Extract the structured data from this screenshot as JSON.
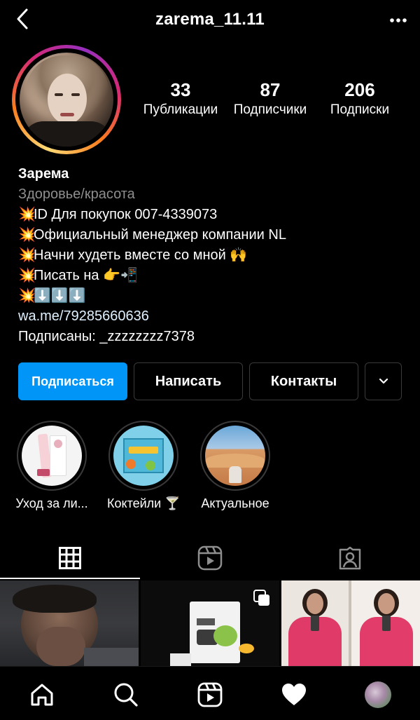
{
  "header": {
    "username": "zarema_11.11"
  },
  "stats": [
    {
      "value": "33",
      "label": "Публикации"
    },
    {
      "value": "87",
      "label": "Подписчики"
    },
    {
      "value": "206",
      "label": "Подписки"
    }
  ],
  "bio": {
    "name": "Зарема",
    "category": "Здоровье/красота",
    "lines": [
      "ID Для покупок 007-4339073",
      "Официальный менеджер компании NL",
      "Начни худеть вместе со мной 🙌",
      "Писать на 👉📲",
      "⬇️⬇️⬇️"
    ],
    "burst": "💥",
    "link": "wa.me/79285660636",
    "followed_by": "Подписаны: _zzzzzzzz7378"
  },
  "buttons": {
    "follow": "Подписаться",
    "message": "Написать",
    "contacts": "Контакты"
  },
  "highlights": [
    {
      "label": "Уход за ли..."
    },
    {
      "label": "Коктейли 🍸"
    },
    {
      "label": "Актуальное"
    }
  ],
  "icons": {
    "back": "chevron-left-icon",
    "more": "more-horizontal-icon",
    "grid": "grid-icon",
    "reels": "reels-icon",
    "tagged": "tagged-icon",
    "home": "home-icon",
    "search": "search-icon",
    "activity": "heart-icon"
  },
  "colors": {
    "primary": "#0095f6",
    "link": "#e0f1ff",
    "muted": "#8e8e8e"
  }
}
